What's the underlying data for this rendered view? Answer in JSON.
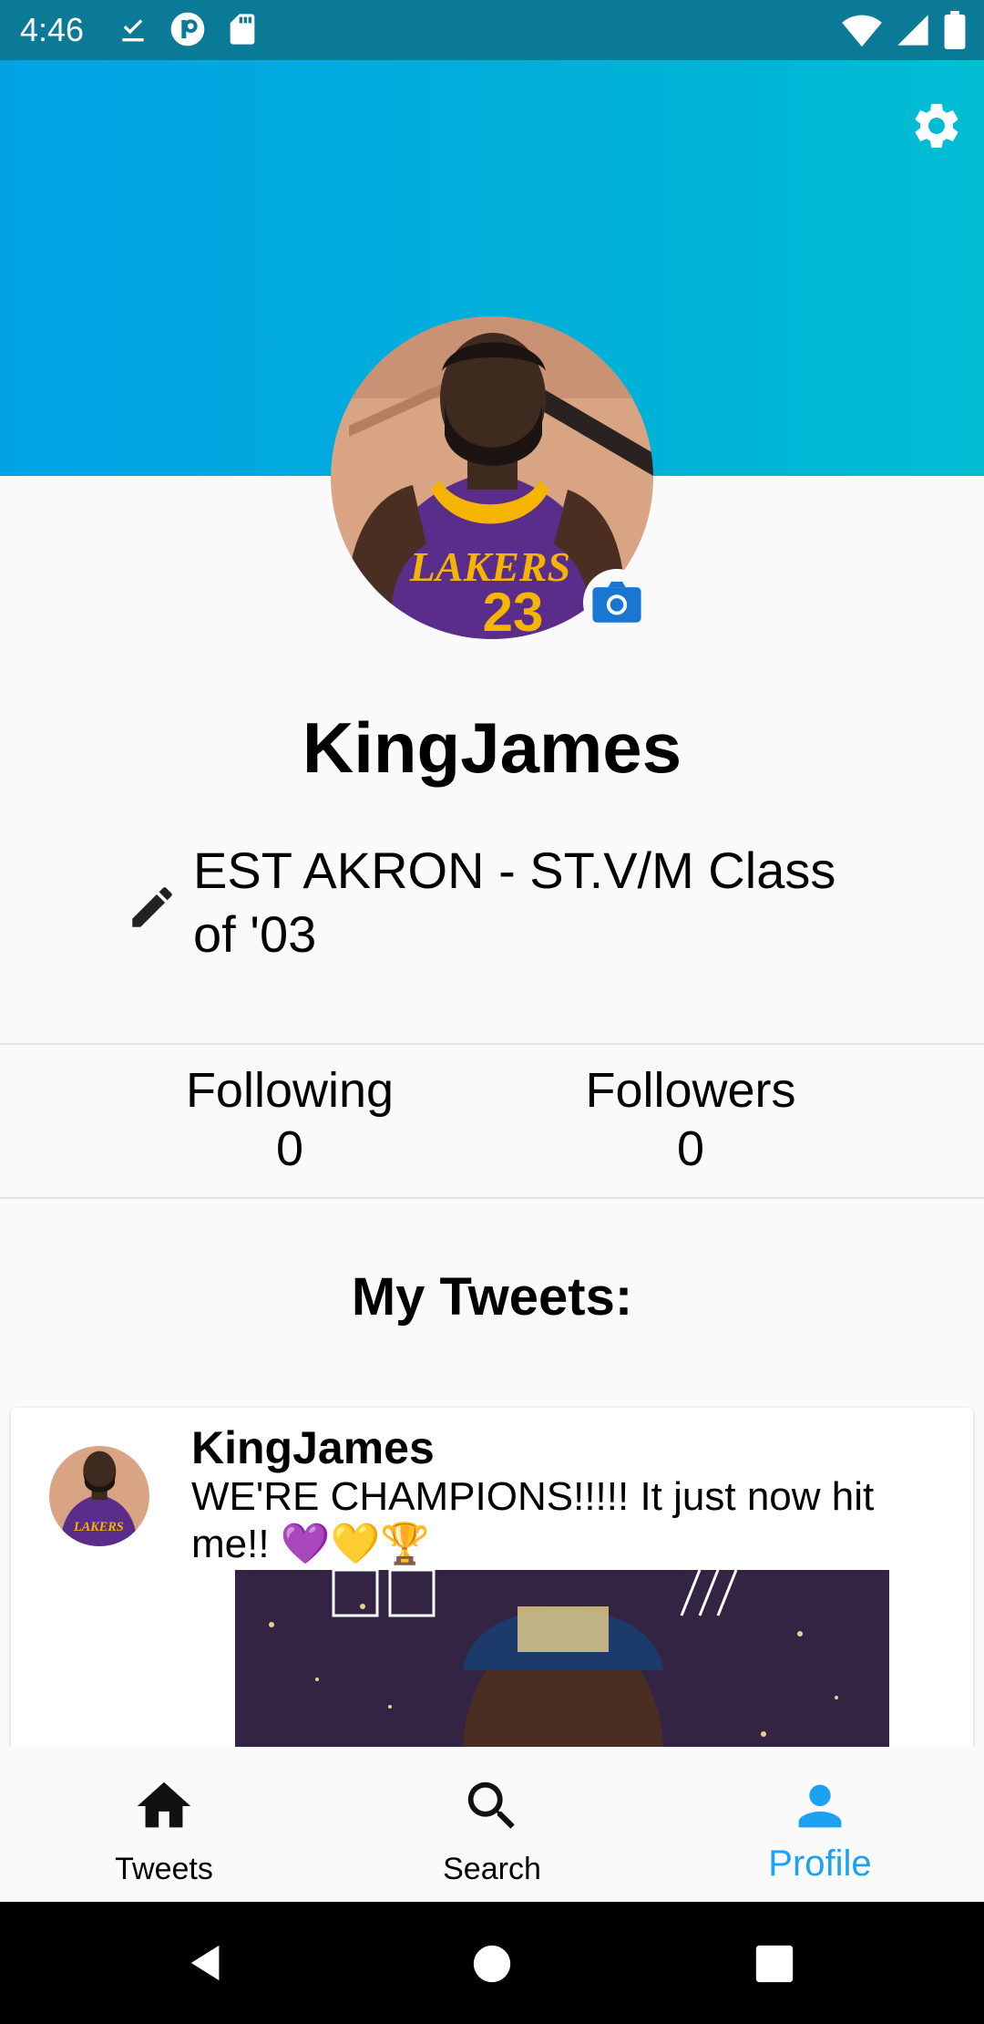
{
  "status_bar": {
    "time": "4:46",
    "left_icons": [
      "download-done-icon",
      "pocket-app-icon",
      "sd-card-icon"
    ],
    "right_icons": [
      "wifi-icon",
      "signal-icon",
      "battery-icon"
    ]
  },
  "profile": {
    "username": "KingJames",
    "bio": "EST AKRON - ST.V/M Class of '03",
    "stats": {
      "following_label": "Following",
      "following_count": "0",
      "followers_label": "Followers",
      "followers_count": "0"
    }
  },
  "tweets_section": {
    "title": "My Tweets:",
    "tweets": [
      {
        "author": "KingJames",
        "text": "WE'RE CHAMPIONS!!!!! It just now hit me!! 💜💛🏆"
      }
    ]
  },
  "bottom_nav": {
    "items": [
      {
        "label": "Tweets",
        "icon": "home-icon",
        "active": false
      },
      {
        "label": "Search",
        "icon": "search-icon",
        "active": false
      },
      {
        "label": "Profile",
        "icon": "person-icon",
        "active": true
      }
    ]
  },
  "colors": {
    "status_bar": "#0a7a97",
    "banner_start": "#01a3e6",
    "banner_end": "#00bdd3",
    "accent": "#1fa1f2",
    "camera_button": "#1976d2",
    "background": "#fafafa"
  }
}
